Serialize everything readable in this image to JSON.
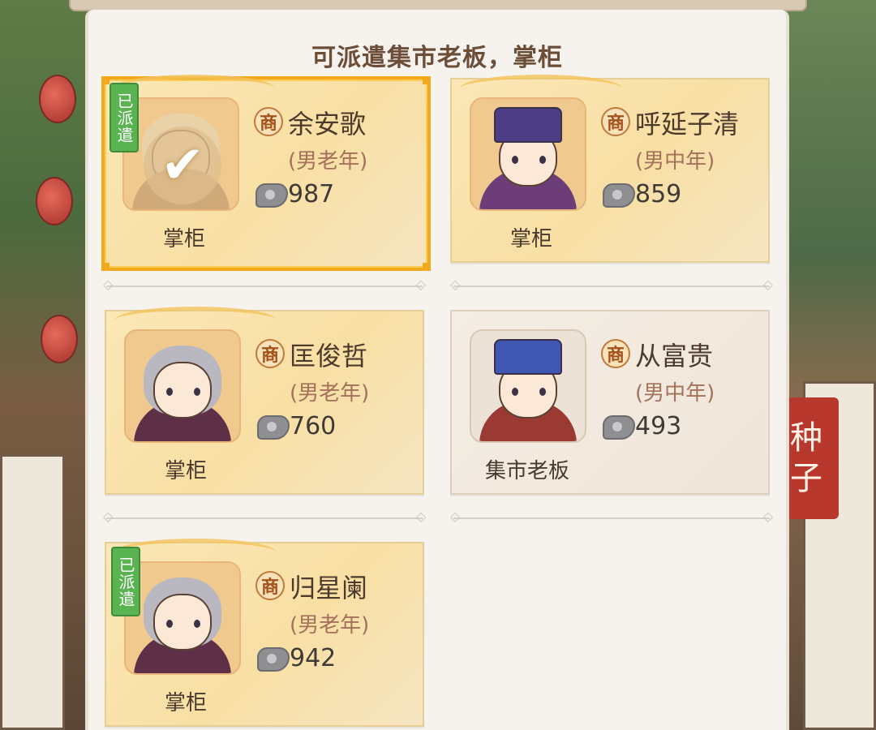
{
  "title": "可派遣集市老板，掌柜",
  "side_seal": [
    "种",
    "子"
  ],
  "colors": {
    "accent": "#f3a91c",
    "dispatched_tag": "#5ab351",
    "title": "#6c4d38"
  },
  "cards": [
    {
      "name": "余安歌",
      "badge": "商",
      "detail": "(男老年)",
      "power": "987",
      "role": "掌柜",
      "dispatched": true,
      "dispatched_label": "已派遣",
      "selected": true,
      "check_icon": "✔"
    },
    {
      "name": "呼延子清",
      "badge": "商",
      "detail": "(男中年)",
      "power": "859",
      "role": "掌柜",
      "dispatched": false,
      "selected": false
    },
    {
      "name": "匡俊哲",
      "badge": "商",
      "detail": "(男老年)",
      "power": "760",
      "role": "掌柜",
      "dispatched": false,
      "selected": false
    },
    {
      "name": "从富贵",
      "badge": "商",
      "detail": "(男中年)",
      "power": "493",
      "role": "集市老板",
      "dispatched": false,
      "selected": false
    },
    {
      "name": "归星阑",
      "badge": "商",
      "detail": "(男老年)",
      "power": "942",
      "role": "掌柜",
      "dispatched": true,
      "dispatched_label": "已派遣",
      "selected": false
    }
  ]
}
